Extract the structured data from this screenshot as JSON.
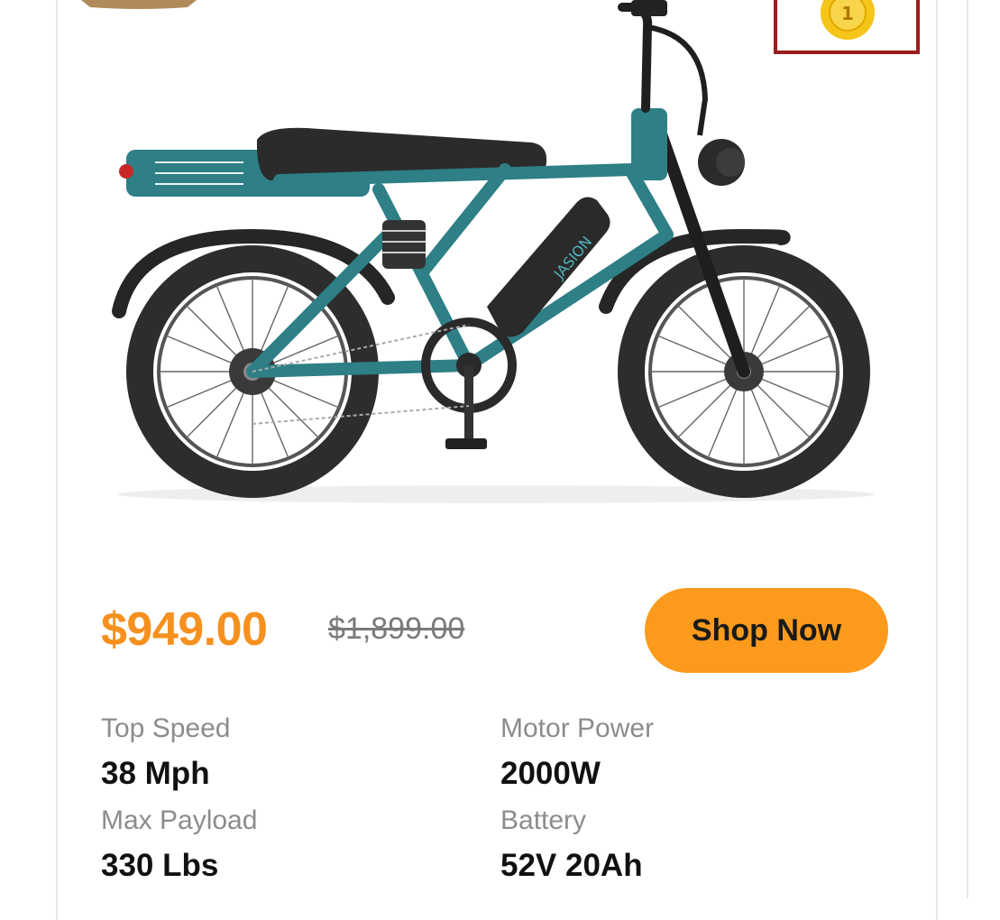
{
  "product": {
    "price": "$949.00",
    "original_price": "$1,899.00",
    "cta_label": "Shop Now",
    "colors": {
      "price": "#f6901e",
      "button": "#fb9a1c",
      "frame": "#2e7f86"
    }
  },
  "specs": [
    {
      "label": "Top Speed",
      "value": "38 Mph"
    },
    {
      "label": "Motor Power",
      "value": "2000W"
    },
    {
      "label": "Max Payload",
      "value": "330 Lbs"
    },
    {
      "label": "Battery",
      "value": "52V 20Ah"
    }
  ],
  "image": {
    "subject": "teal fat-tire electric bike",
    "brand_mark": "JASION"
  }
}
